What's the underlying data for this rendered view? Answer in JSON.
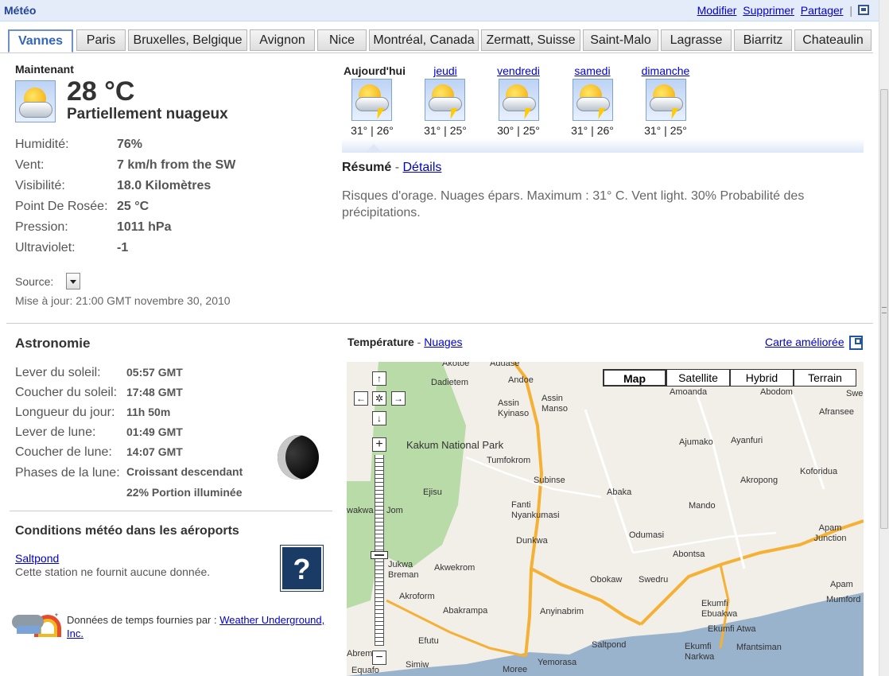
{
  "header": {
    "title": "Météo",
    "links": [
      "Modifier",
      "Supprimer",
      "Partager"
    ],
    "separator": "|"
  },
  "tabs": [
    "Vannes",
    "Paris",
    "Bruxelles, Belgique",
    "Avignon",
    "Nice",
    "Montréal, Canada",
    "Zermatt, Suisse",
    "Saint-Malo",
    "Lagrasse",
    "Biarritz",
    "Chateaulin"
  ],
  "current": {
    "heading": "Maintenant",
    "temp": "28 °C",
    "condition": "Partiellement nuageux",
    "details": [
      {
        "label": "Humidité:",
        "value": "76%"
      },
      {
        "label": "Vent:",
        "value": "7 km/h from the SW"
      },
      {
        "label": "Visibilité:",
        "value": "18.0 Kilomètres"
      },
      {
        "label": "Point De Rosée:",
        "value": "25 °C"
      },
      {
        "label": "Pression:",
        "value": "1011 hPa"
      },
      {
        "label": "Ultraviolet:",
        "value": "-1"
      }
    ],
    "source_label": "Source:",
    "updated": "Mise à jour: 21:00 GMT novembre 30, 2010"
  },
  "forecast": {
    "days": [
      {
        "day": "Aujourd'hui",
        "temps": "31° | 26°",
        "icon": "thunderstorm-icon"
      },
      {
        "day": "jeudi",
        "temps": "31° | 25°",
        "icon": "thunderstorm-icon"
      },
      {
        "day": "vendredi",
        "temps": "30° | 25°",
        "icon": "thunderstorm-icon"
      },
      {
        "day": "samedi",
        "temps": "31° | 26°",
        "icon": "thunderstorm-icon"
      },
      {
        "day": "dimanche",
        "temps": "31° | 25°",
        "icon": "thunderstorm-icon"
      }
    ],
    "summary_label": "Résumé",
    "details_link": "Détails",
    "dash": "-",
    "summary_text": "Risques d'orage. Nuages épars. Maximum : 31° C. Vent light. 30% Probabilité des précipitations."
  },
  "astronomy": {
    "heading": "Astronomie",
    "rows": [
      {
        "label": "Lever du soleil:",
        "value": "05:57 GMT"
      },
      {
        "label": "Coucher du soleil:",
        "value": "17:48 GMT"
      },
      {
        "label": "Longueur du jour:",
        "value": "11h 50m"
      },
      {
        "label": "Lever de lune:",
        "value": "01:49 GMT"
      },
      {
        "label": "Coucher de lune:",
        "value": "14:07 GMT"
      },
      {
        "label": "Phases de la lune:",
        "value": "Croissant descendant"
      }
    ],
    "illumination": "22% Portion illuminée"
  },
  "airports": {
    "heading": "Conditions météo dans les aéroports",
    "station": "Saltpond",
    "message": "Cette station ne fournit aucune donnée.",
    "unknown_symbol": "?"
  },
  "credits": {
    "prefix": "Données de temps fournies par :",
    "provider": "Weather Underground, Inc.",
    "asterisk": "*"
  },
  "map": {
    "temp_label": "Température",
    "dash": "-",
    "clouds_link": "Nuages",
    "enhanced_link": "Carte améliorée",
    "types": [
      "Map",
      "Satellite",
      "Hybrid",
      "Terrain"
    ],
    "active_type": "Map",
    "nav": {
      "up": "↑",
      "down": "↓",
      "left": "←",
      "right": "→",
      "center": "✲",
      "zoom_in": "+",
      "zoom_out": "−"
    },
    "park": "Kakum National Park",
    "towns": [
      "Akotoe",
      "Aduase",
      "Dadietem",
      "Andoe",
      "Assin Kyinaso",
      "Assin Manso",
      "Amoanda",
      "Abodom",
      "Swe",
      "Afransee",
      "Ajumako",
      "Ayanfuri",
      "Tumfokrom",
      "Subinse",
      "Akropong",
      "Koforidua",
      "Ejisu",
      "Abaka",
      "Fanti Nyankumasi",
      "Mando",
      "wakwa",
      "Jom",
      "Dunkwa",
      "Odumasi",
      "Apam Junction",
      "Jukwa",
      "Breman",
      "Akwekrom",
      "Abontsa",
      "Obokaw",
      "Swedru",
      "Akroform",
      "Apam",
      "Mumford",
      "Abakrampa",
      "Anyinabrim",
      "Ekumfi Ebuakwa",
      "Ekumfi Atwa",
      "Efutu",
      "Saltpond",
      "Ekumfi Narkwa",
      "Mfantsiman",
      "Abrem",
      "Simiw",
      "Yemorasa",
      "Equafo",
      "Moree"
    ]
  }
}
